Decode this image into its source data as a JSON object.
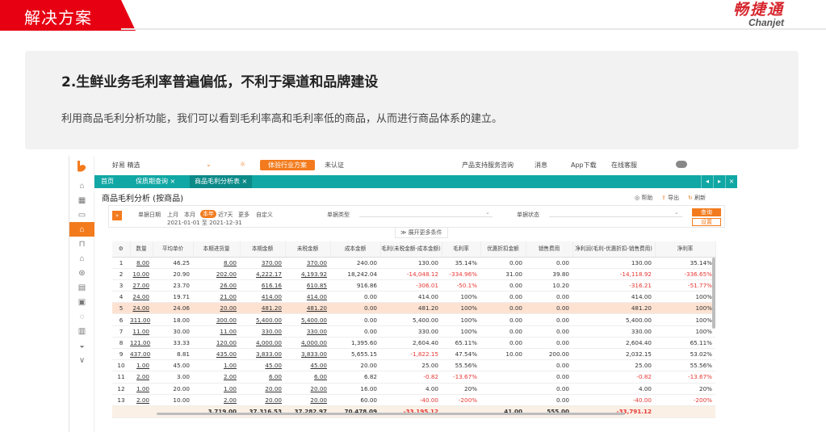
{
  "slide": {
    "banner": "解决方案",
    "logo_cn": "畅捷通",
    "logo_en": "Chanjet",
    "heading": "2.生鲜业务毛利率普遍偏低，不利于渠道和品牌建设",
    "body": "利用商品毛利分析功能，我们可以看到毛利率高和毛利率低的商品，从而进行商品体系的建立。",
    "colors": {
      "banner": "#e60012",
      "accent": "#f37b1d",
      "tabbar": "#10a7a4",
      "negative": "#e53935"
    }
  },
  "app": {
    "store": "好易 精选",
    "trade_btn": "体验行业方案",
    "auth": "未认证",
    "topright": [
      "产品支持服务咨询",
      "消息",
      "App下载",
      "在线客服"
    ],
    "tabs": [
      "首页",
      "保质期查询 ×",
      "商品毛利分析表 ×"
    ],
    "page_title": "商品毛利分析 (按商品)",
    "actions": [
      "帮助",
      "导出",
      "刷新"
    ],
    "filter": {
      "date_label": "单据日期",
      "periods": [
        "上月",
        "本月",
        "本年",
        "近7天",
        "更多",
        "自定义"
      ],
      "active_period": "本年",
      "range": "2021-01-01 至 2021-12-31",
      "type_label": "单据类型",
      "status_label": "单据状态",
      "query": "查询",
      "settings": "设置",
      "expand": "展开更多条件"
    },
    "columns": [
      "",
      "数量",
      "平均单价",
      "本期进货量",
      "本期金额",
      "未税金额",
      "成本金额",
      "毛利(未税金额-成本金额)",
      "毛利率",
      "优惠折扣金额",
      "销售费用",
      "净利润(毛利-优惠折扣-销售费用)",
      "净利率"
    ],
    "rows": [
      [
        "1",
        "8.00",
        "46.25",
        "8.00",
        "370.00",
        "370.00",
        "240.00",
        "130.00",
        "35.14%",
        "0.00",
        "0.00",
        "130.00",
        "35.14%"
      ],
      [
        "2",
        "10.00",
        "20.90",
        "202.00",
        "4,222.17",
        "4,193.92",
        "18,242.04",
        "-14,048.12",
        "-334.96%",
        "31.00",
        "39.80",
        "-14,118.92",
        "-336.65%"
      ],
      [
        "3",
        "27.00",
        "23.70",
        "26.00",
        "616.16",
        "610.85",
        "916.86",
        "-306.01",
        "-50.1%",
        "0.00",
        "10.20",
        "-316.21",
        "-51.77%"
      ],
      [
        "4",
        "24.00",
        "19.71",
        "21.00",
        "414.00",
        "414.00",
        "0.00",
        "414.00",
        "100%",
        "0.00",
        "0.00",
        "414.00",
        "100%"
      ],
      [
        "5",
        "24.00",
        "24.06",
        "20.00",
        "481.20",
        "481.20",
        "0.00",
        "481.20",
        "100%",
        "0.00",
        "0.00",
        "481.20",
        "100%"
      ],
      [
        "6",
        "311.00",
        "18.00",
        "300.00",
        "5,400.00",
        "5,400.00",
        "0.00",
        "5,400.00",
        "100%",
        "0.00",
        "0.00",
        "5,400.00",
        "100%"
      ],
      [
        "7",
        "11.00",
        "30.00",
        "11.00",
        "330.00",
        "330.00",
        "0.00",
        "330.00",
        "100%",
        "0.00",
        "0.00",
        "330.00",
        "100%"
      ],
      [
        "8",
        "121.00",
        "33.33",
        "120.00",
        "4,000.00",
        "4,000.00",
        "1,395.60",
        "2,604.40",
        "65.11%",
        "0.00",
        "0.00",
        "2,604.40",
        "65.11%"
      ],
      [
        "9",
        "437.00",
        "8.81",
        "435.00",
        "3,833.00",
        "3,833.00",
        "5,655.15",
        "-1,822.15",
        "47.54%",
        "10.00",
        "200.00",
        "2,032.15",
        "53.02%"
      ],
      [
        "10",
        "1.00",
        "45.00",
        "1.00",
        "45.00",
        "45.00",
        "20.00",
        "25.00",
        "55.56%",
        "",
        "0.00",
        "25.00",
        "55.56%"
      ],
      [
        "11",
        "2.00",
        "3.00",
        "2.00",
        "6.00",
        "6.00",
        "6.82",
        "-0.82",
        "-13.67%",
        "",
        "0.00",
        "-0.82",
        "-13.67%"
      ],
      [
        "12",
        "1.00",
        "20.00",
        "1.00",
        "20.00",
        "20.00",
        "16.00",
        "4.00",
        "20%",
        "",
        "0.00",
        "4.00",
        "20%"
      ],
      [
        "13",
        "2.00",
        "10.00",
        "2.00",
        "20.00",
        "20.00",
        "60.00",
        "-40.00",
        "-200%",
        "",
        "0.00",
        "-40.00",
        "-200%"
      ]
    ],
    "totals": [
      "",
      "",
      "",
      "3,719.00",
      "37,316.53",
      "37,282.97",
      "70,478.09",
      "-33,195.12",
      "",
      "41.00",
      "555.00",
      "-33,791.12",
      ""
    ],
    "highlight_row": 4
  }
}
